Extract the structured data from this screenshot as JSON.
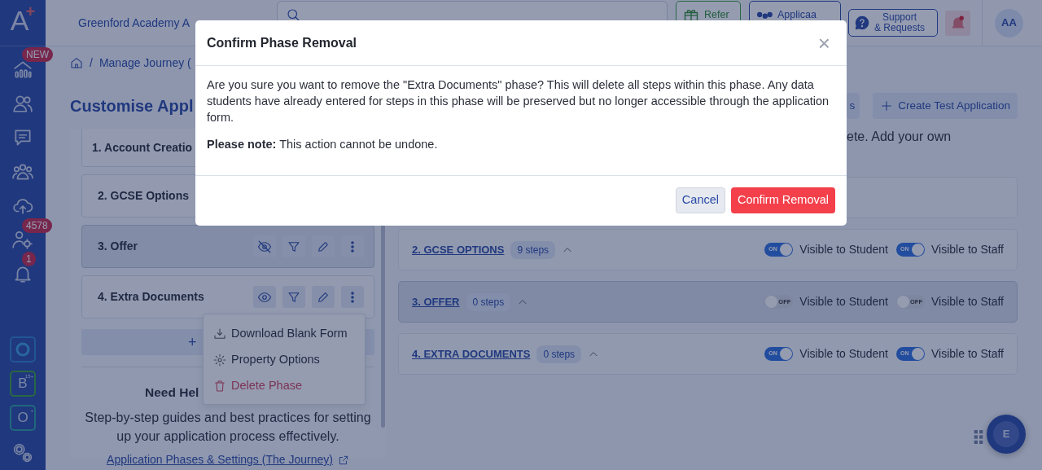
{
  "sidebar": {
    "logo": "A",
    "logo_mark": "+",
    "badges": [
      "NEW",
      "4578",
      "1"
    ],
    "apps": [
      {
        "kind": "ring"
      },
      {
        "kind": "letter",
        "letter": "B",
        "mark": "15+"
      },
      {
        "kind": "letter",
        "letter": "O",
        "mark": "+"
      }
    ]
  },
  "header": {
    "school": "Greenford Academy A",
    "buttons": [
      {
        "kind": "refer",
        "lines": [
          "Refer"
        ]
      },
      {
        "kind": "applicaa",
        "lines": [
          "Applicaa"
        ]
      },
      {
        "kind": "support",
        "lines": [
          "Support",
          "& Requests"
        ]
      }
    ],
    "avatar": "AA"
  },
  "breadcrumb": {
    "separator": "/",
    "current": "Manage Journey ("
  },
  "page_title": "Customise Appl",
  "actions": [
    {
      "label": "s",
      "plus": false
    },
    {
      "label": "Create Test Application",
      "plus": true
    }
  ],
  "description": "ete. Add your own",
  "phases": [
    {
      "title": "1. Account Creatio",
      "selected": false
    },
    {
      "title": "2. GCSE Options",
      "selected": false
    },
    {
      "title": "3. Offer",
      "selected": true,
      "visible": false
    },
    {
      "title": "4. Extra Documents",
      "selected": false,
      "visible": true
    }
  ],
  "add_phase": "+",
  "menu": [
    {
      "kind": "download",
      "label": "Download Blank Form"
    },
    {
      "kind": "settings",
      "label": "Property Options"
    },
    {
      "kind": "delete",
      "label": "Delete Phase"
    }
  ],
  "help": {
    "title": "Need Hel",
    "text": "Step-by-step guides and best practices for setting up your application process effectively.",
    "link": "Application Phases & Settings (The Journey)"
  },
  "journey": [
    {
      "title": "2. GCSE OPTIONS",
      "steps": "9 steps",
      "selected": false,
      "toggles": [
        {
          "on": true,
          "state": "ON",
          "label": "Visible to Student"
        },
        {
          "on": true,
          "state": "ON",
          "label": "Visible to Staff"
        }
      ]
    },
    {
      "title": "3. OFFER",
      "steps": "0 steps",
      "selected": true,
      "toggles": [
        {
          "on": false,
          "state": "OFF",
          "label": "Visible to Student"
        },
        {
          "on": false,
          "state": "OFF",
          "label": "Visible to Staff"
        }
      ]
    },
    {
      "title": "4. EXTRA DOCUMENTS",
      "steps": "0 steps",
      "selected": false,
      "toggles": [
        {
          "on": true,
          "state": "ON",
          "label": "Visible to Student"
        },
        {
          "on": true,
          "state": "ON",
          "label": "Visible to Staff"
        }
      ]
    }
  ],
  "modal": {
    "title": "Confirm Phase Removal",
    "close": "×",
    "body": "Are you sure you want to remove the \"Extra Documents\" phase? This will delete all steps within this phase. Any data students have already entered for steps in this phase will be preserved but no longer accessible through the application form.",
    "note": "**Please note:** This action cannot be undone.",
    "buttons": [
      {
        "kind": "cancel",
        "label": "Cancel"
      },
      {
        "kind": "danger",
        "label": "Confirm Removal"
      }
    ]
  },
  "fab": "E"
}
